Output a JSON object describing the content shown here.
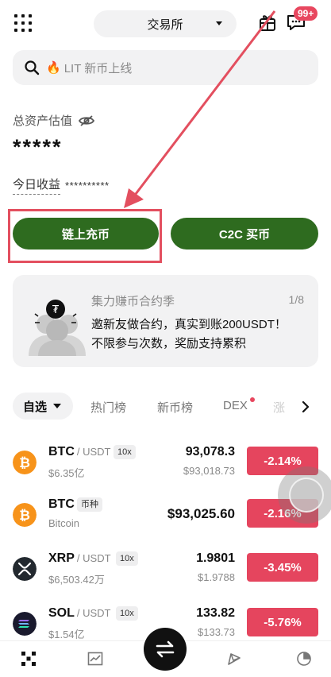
{
  "header": {
    "exchange_label": "交易所",
    "notification_count": "99+"
  },
  "search": {
    "placeholder": "LIT 新币上线"
  },
  "assets": {
    "label": "总资产估值",
    "value": "*****",
    "today_label": "今日收益",
    "today_value": "**********"
  },
  "actions": {
    "deposit_label": "链上充币",
    "c2c_label": "C2C 买币"
  },
  "promo": {
    "title": "集力赚币合约季",
    "pager": "1/8",
    "line1": "邀新友做合约，真实到账200USDT！",
    "line2": "不限参与次数，奖励支持累积"
  },
  "tabs": {
    "selected": "自选",
    "items": [
      "热门榜",
      "新币榜",
      "DEX"
    ],
    "partial": "涨"
  },
  "markets": [
    {
      "symbol": "BTC",
      "quote": "/ USDT",
      "tag": "10x",
      "sub": "$6.35亿",
      "price": "93,078.3",
      "price_usd": "$93,018.73",
      "change": "-2.14%",
      "icon": "bitcoin-icon",
      "color": "#f7931a"
    },
    {
      "symbol": "BTC",
      "quote": "",
      "tag": "币种",
      "sub": "Bitcoin",
      "price": "$93,025.60",
      "price_usd": "",
      "change": "-2.16%",
      "icon": "bitcoin-icon",
      "color": "#f7931a"
    },
    {
      "symbol": "XRP",
      "quote": "/ USDT",
      "tag": "10x",
      "sub": "$6,503.42万",
      "price": "1.9801",
      "price_usd": "$1.9788",
      "change": "-3.45%",
      "icon": "xrp-icon",
      "color": "#23292f"
    },
    {
      "symbol": "SOL",
      "quote": "/ USDT",
      "tag": "10x",
      "sub": "$1.54亿",
      "price": "133.82",
      "price_usd": "$133.73",
      "change": "-5.76%",
      "icon": "solana-icon",
      "color": "#1a1a2e"
    }
  ],
  "colors": {
    "accent_green": "#2e6b1f",
    "down_red": "#e5455e",
    "annotation_red": "#e34f5f"
  }
}
